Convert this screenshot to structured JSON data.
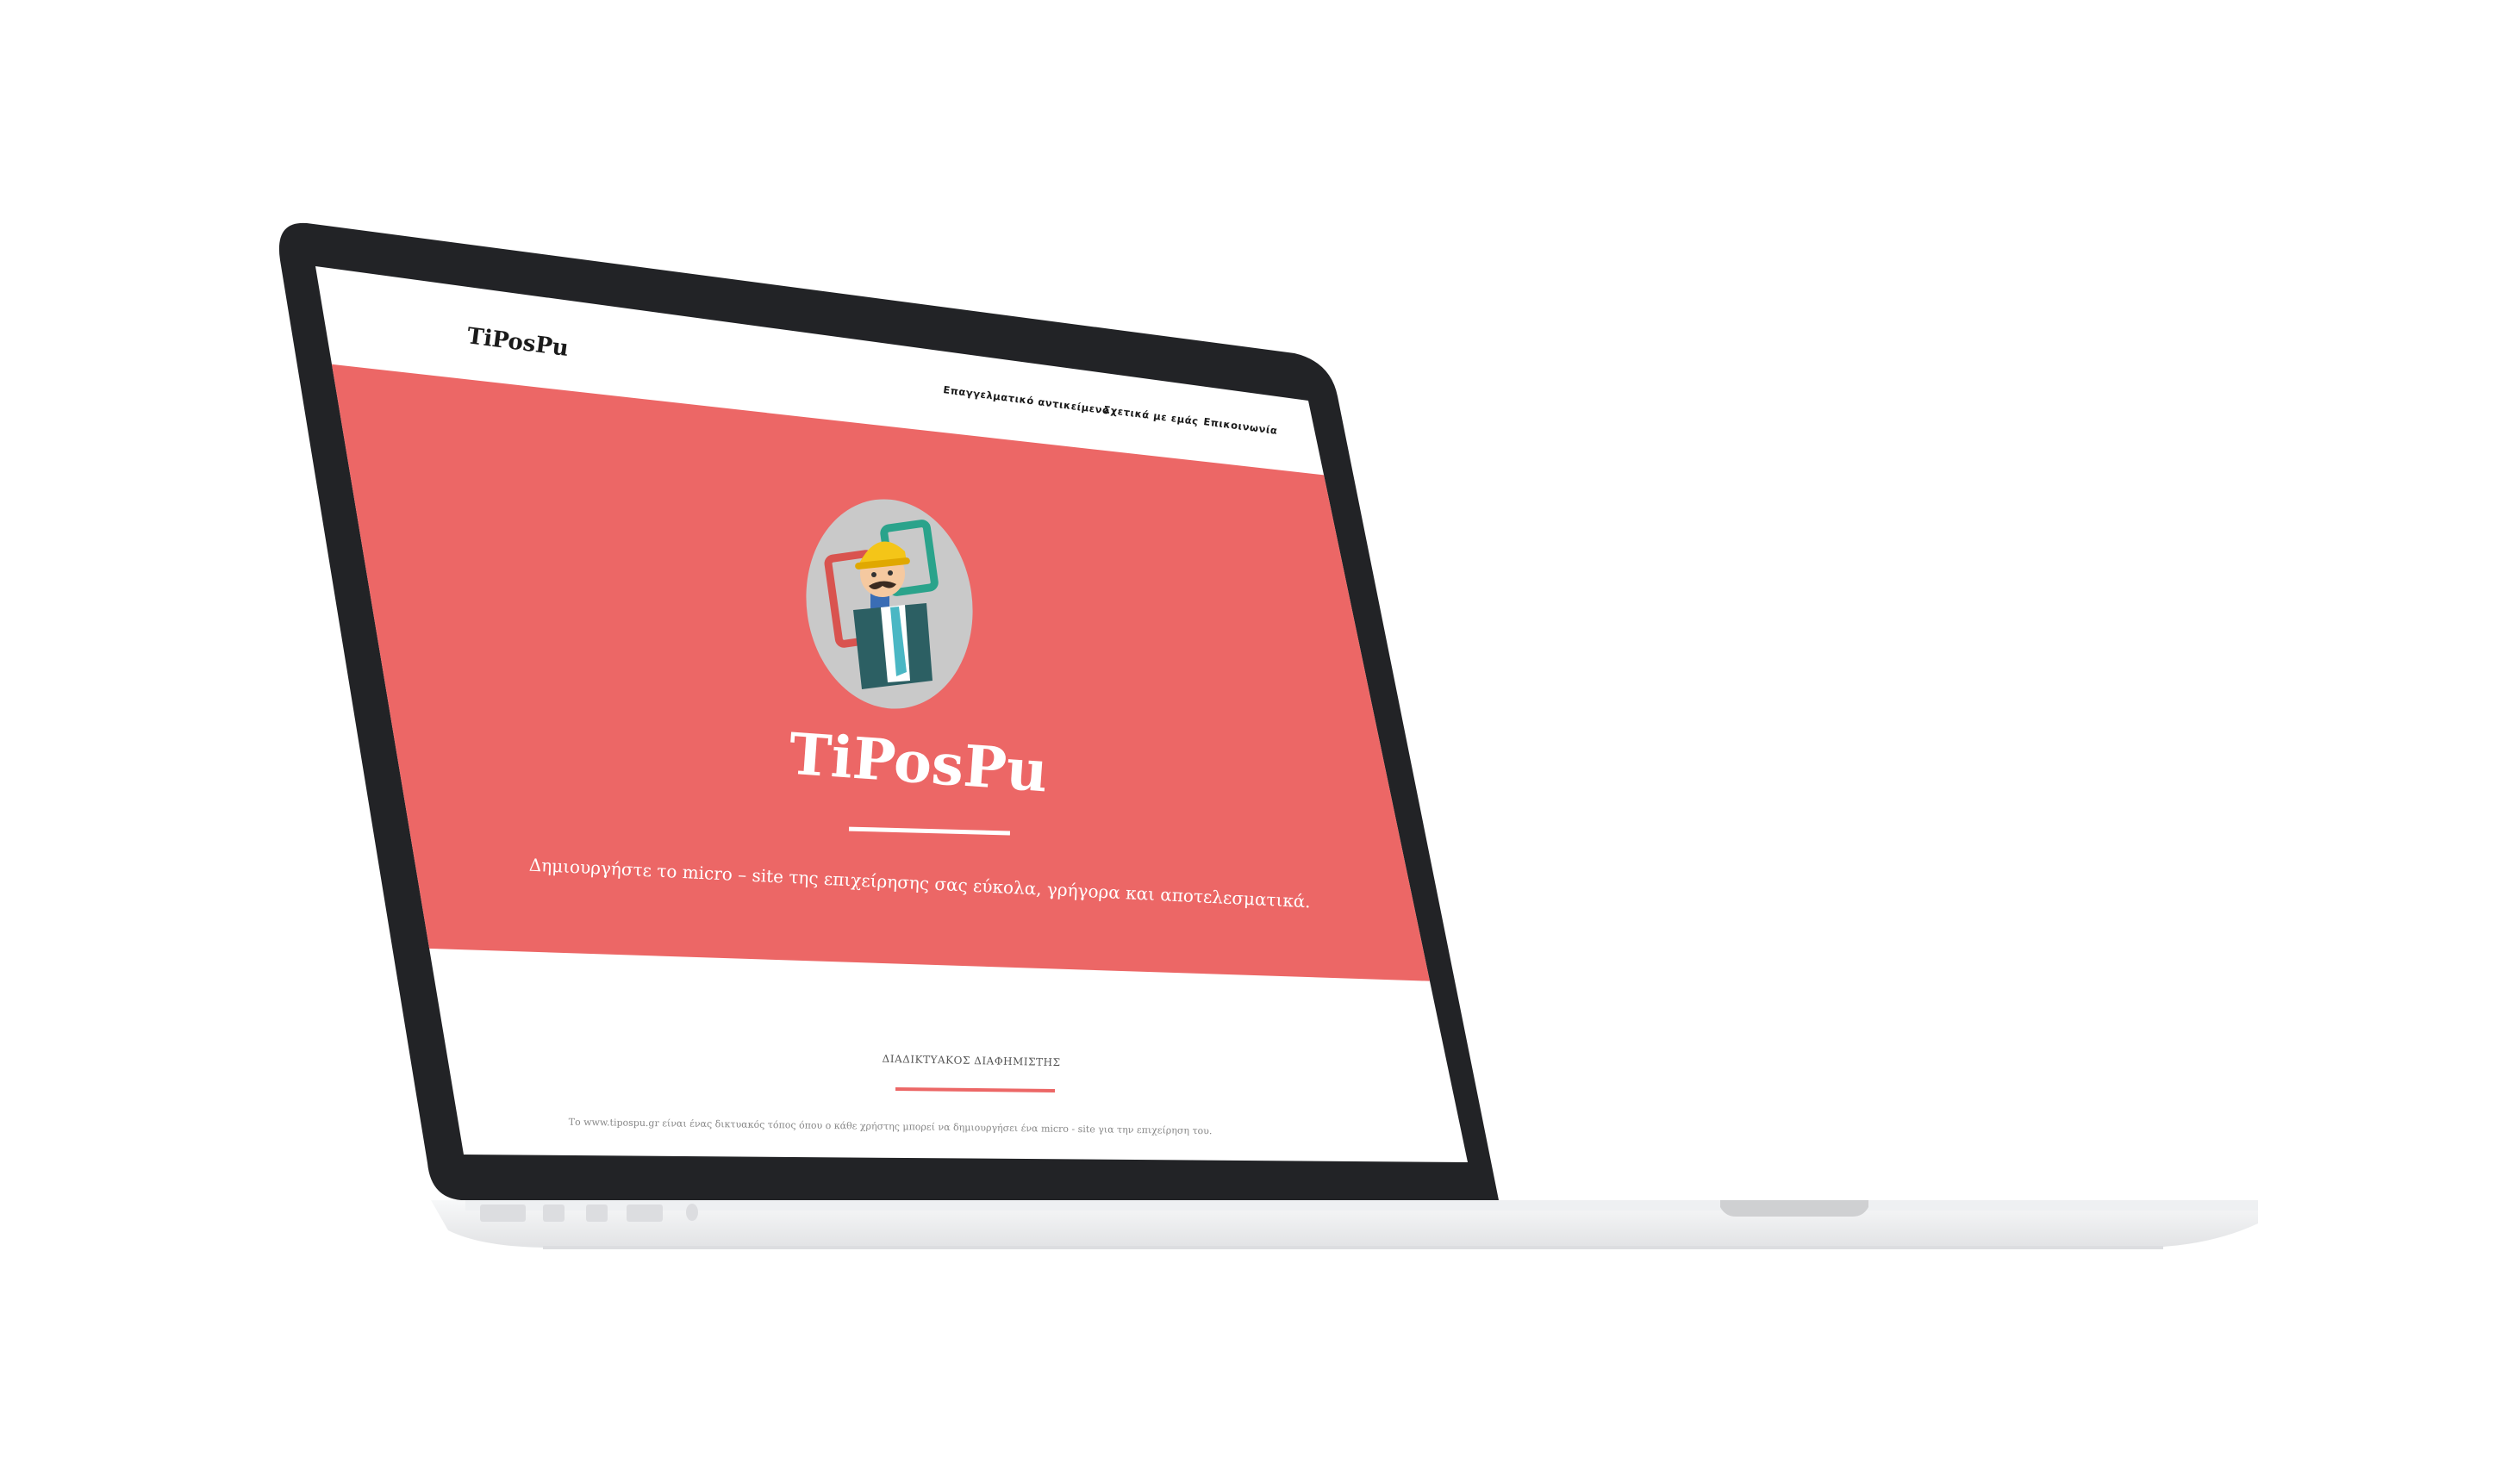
{
  "site": {
    "logo_text": "TiPosPu",
    "nav": [
      "Επαγγελματικό αντικείμενο",
      "Σχετικά με εμάς",
      "Επικοινωνία"
    ],
    "hero_title": "TiPosPu",
    "hero_subtitle": "Δημιουργήστε το micro – site της επιχείρησης σας εύκολα, γρήγορα και αποτελεσματικά.",
    "section_heading": "ΔΙΑΔΙΚΤΥΑΚΟΣ ΔΙΑΦΗΜΙΣΤΗΣ",
    "section_text": "Το www.tipospu.gr είναι ένας δικτυακός τόπος όπου ο κάθε χρήστης μπορεί να δημιουργήσει ένα micro - site για την επιχείρηση του."
  },
  "colors": {
    "hero": "#ec6766",
    "bezel": "#222326",
    "page_bg": "#ffffff",
    "laptop_base": "#f3f4f5",
    "avatar_circle": "#c9c9c9",
    "accent_underline": "#ec6766"
  },
  "mascot": {
    "icon": "construction-worker-avatar-icon"
  }
}
